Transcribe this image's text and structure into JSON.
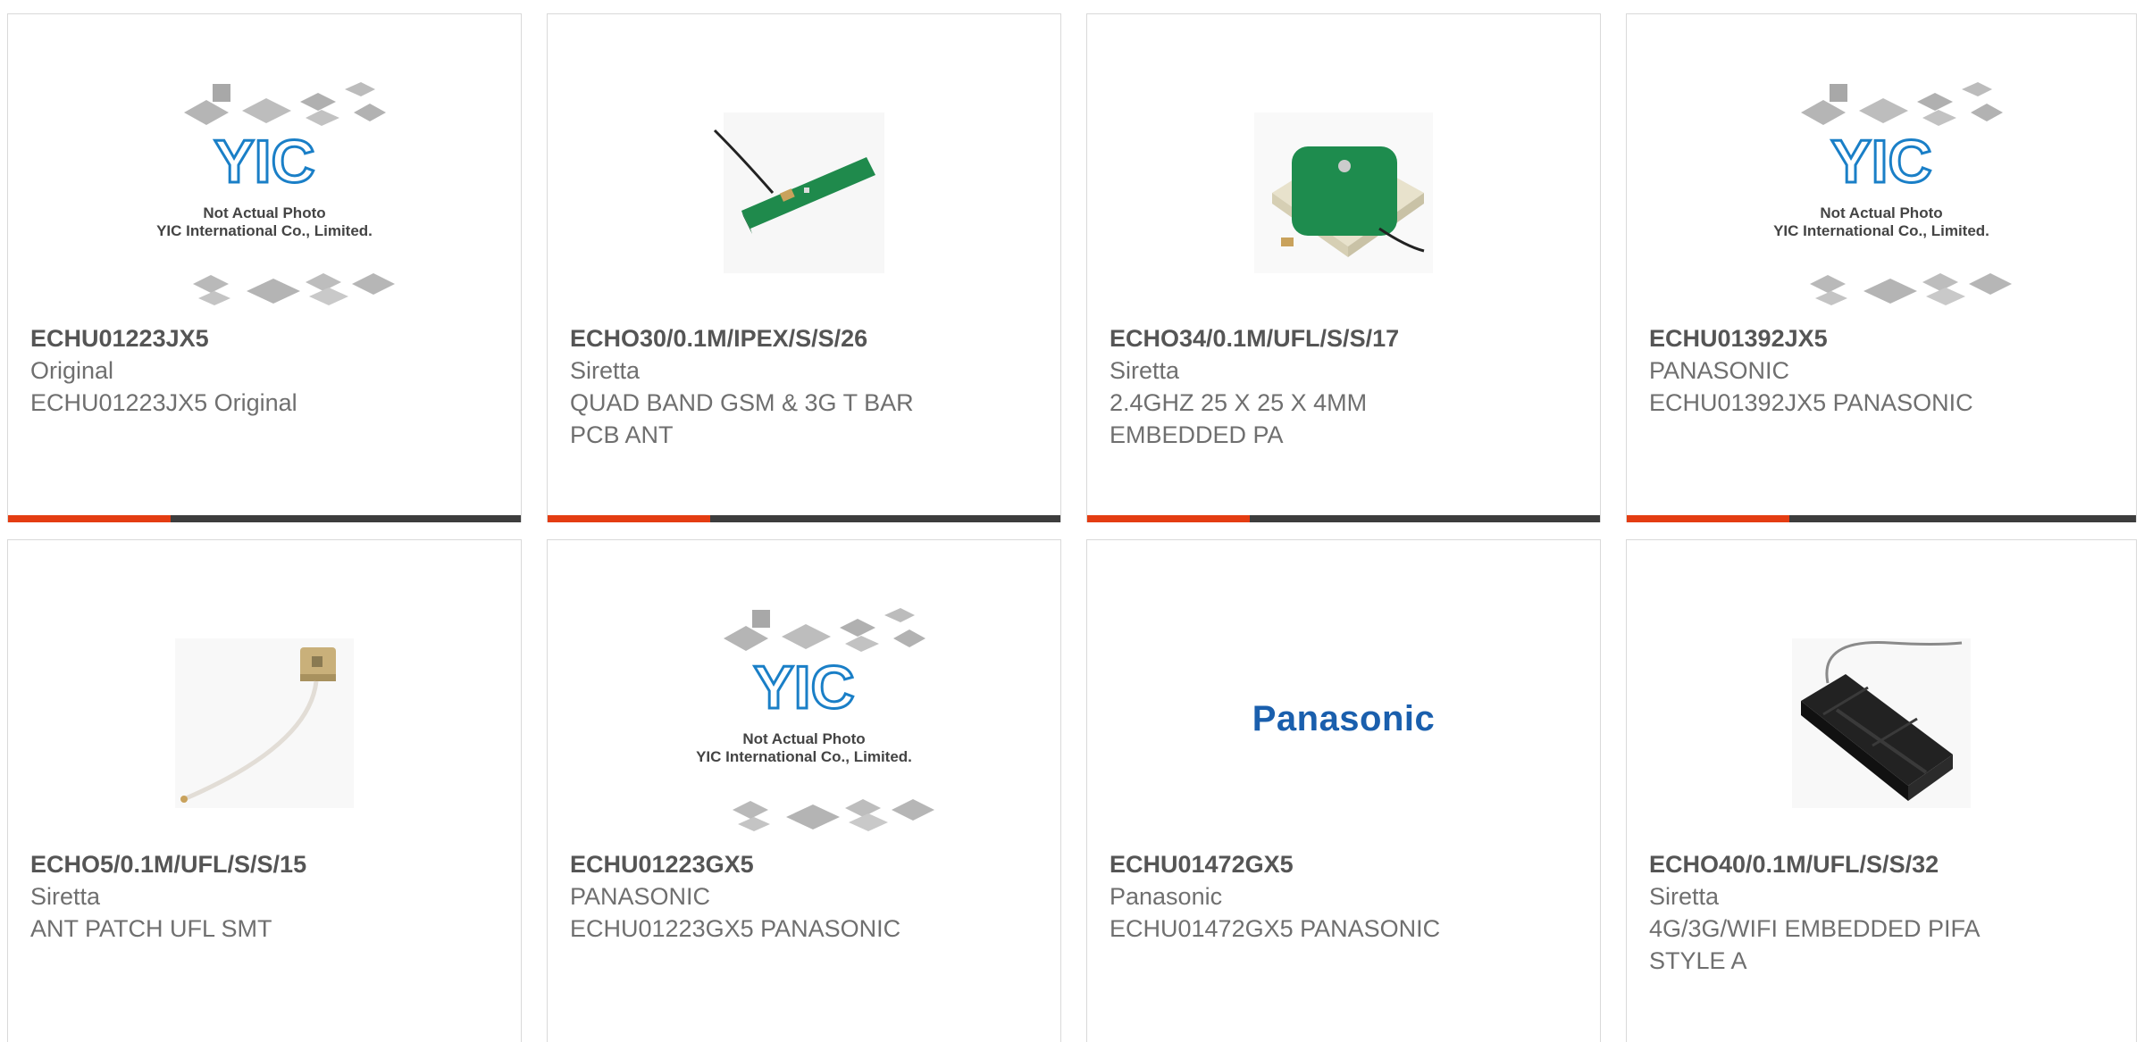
{
  "colors": {
    "accent": "#e43d12",
    "bar": "#3d3d3d",
    "text": "#6f6f6f",
    "part": "#555555",
    "placeholder_logo": "#1a7fc7",
    "panasonic": "#1a5fad"
  },
  "placeholder": {
    "logo_text": "YIC",
    "line1": "Not Actual Photo",
    "line2": "YIC International Co., Limited."
  },
  "products": [
    {
      "part": "ECHU01223JX5",
      "manufacturer": "Original",
      "description": [
        "ECHU01223JX5 Original"
      ],
      "image": "placeholder-photo"
    },
    {
      "part": "ECHO30/0.1M/IPEX/S/S/26",
      "manufacturer": "Siretta",
      "description": [
        "QUAD BAND GSM & 3G T BAR",
        "PCB ANT"
      ],
      "image": "pcb-antenna-photo"
    },
    {
      "part": "ECHO34/0.1M/UFL/S/S/17",
      "manufacturer": "Siretta",
      "description": [
        "2.4GHZ 25 X 25 X 4MM",
        "EMBEDDED PA"
      ],
      "image": "patch-antenna-photo"
    },
    {
      "part": "ECHU01392JX5",
      "manufacturer": "PANASONIC",
      "description": [
        "ECHU01392JX5 PANASONIC"
      ],
      "image": "placeholder-photo"
    },
    {
      "part": "ECHO5/0.1M/UFL/S/S/15",
      "manufacturer": "Siretta",
      "description": [
        "ANT PATCH UFL SMT"
      ],
      "image": "small-patch-antenna-photo"
    },
    {
      "part": "ECHU01223GX5",
      "manufacturer": "PANASONIC",
      "description": [
        "ECHU01223GX5 PANASONIC"
      ],
      "image": "placeholder-photo"
    },
    {
      "part": "ECHU01472GX5",
      "manufacturer": "Panasonic",
      "description": [
        "ECHU01472GX5 PANASONIC"
      ],
      "image": "panasonic-logo",
      "logo_text": "Panasonic"
    },
    {
      "part": "ECHO40/0.1M/UFL/S/S/32",
      "manufacturer": "Siretta",
      "description": [
        "4G/3G/WIFI EMBEDDED PIFA",
        "STYLE A"
      ],
      "image": "pifa-antenna-photo"
    }
  ]
}
